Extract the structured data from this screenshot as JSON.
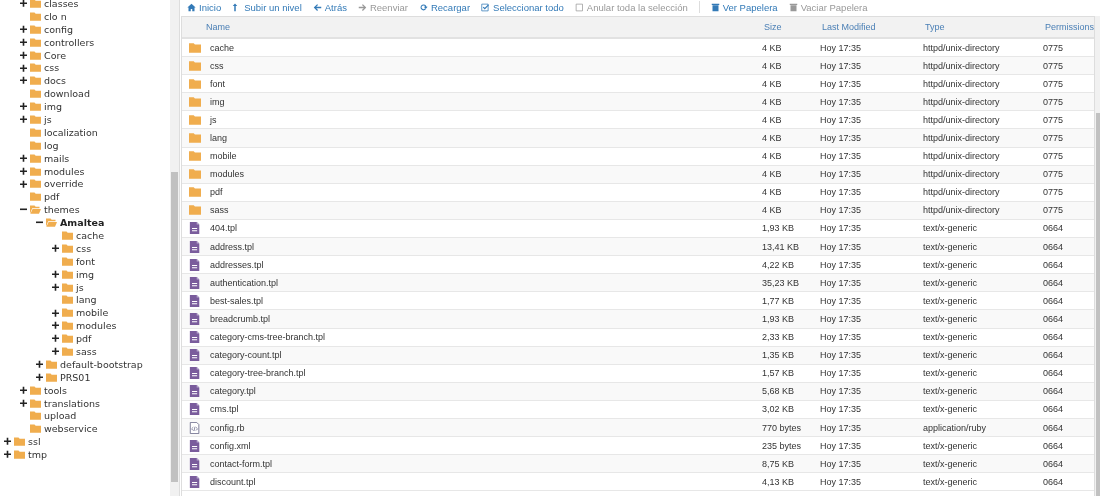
{
  "tree": {
    "items": [
      {
        "children": [
          {
            "label": "classes",
            "expandable": true,
            "expanded": false,
            "selected": false
          },
          {
            "label": "clo n",
            "expandable": false,
            "selected": false
          },
          {
            "label": "config",
            "expandable": true,
            "expanded": false,
            "selected": false
          },
          {
            "label": "controllers",
            "expandable": true,
            "expanded": false,
            "selected": false
          },
          {
            "label": "Core",
            "expandable": true,
            "expanded": false,
            "selected": false
          },
          {
            "label": "css",
            "expandable": true,
            "expanded": false,
            "selected": false
          },
          {
            "label": "docs",
            "expandable": true,
            "expanded": false,
            "selected": false
          },
          {
            "label": "download",
            "expandable": false,
            "selected": false
          },
          {
            "label": "img",
            "expandable": true,
            "expanded": false,
            "selected": false
          },
          {
            "label": "js",
            "expandable": true,
            "expanded": false,
            "selected": false
          },
          {
            "label": "localization",
            "expandable": false,
            "selected": false
          },
          {
            "label": "log",
            "expandable": false,
            "selected": false
          },
          {
            "label": "mails",
            "expandable": true,
            "expanded": false,
            "selected": false
          },
          {
            "label": "modules",
            "expandable": true,
            "expanded": false,
            "selected": false
          },
          {
            "label": "override",
            "expandable": true,
            "expanded": false,
            "selected": false
          },
          {
            "label": "pdf",
            "expandable": false,
            "selected": false
          },
          {
            "label": "themes",
            "expandable": true,
            "expanded": true,
            "selected": false,
            "children": [
              {
                "label": "Amaltea",
                "expandable": true,
                "expanded": true,
                "selected": true,
                "children": [
                  {
                    "label": "cache",
                    "expandable": false,
                    "selected": false
                  },
                  {
                    "label": "css",
                    "expandable": true,
                    "expanded": false,
                    "selected": false
                  },
                  {
                    "label": "font",
                    "expandable": false,
                    "selected": false
                  },
                  {
                    "label": "img",
                    "expandable": true,
                    "expanded": false,
                    "selected": false
                  },
                  {
                    "label": "js",
                    "expandable": true,
                    "expanded": false,
                    "selected": false
                  },
                  {
                    "label": "lang",
                    "expandable": false,
                    "selected": false
                  },
                  {
                    "label": "mobile",
                    "expandable": true,
                    "expanded": false,
                    "selected": false
                  },
                  {
                    "label": "modules",
                    "expandable": true,
                    "expanded": false,
                    "selected": false
                  },
                  {
                    "label": "pdf",
                    "expandable": true,
                    "expanded": false,
                    "selected": false
                  },
                  {
                    "label": "sass",
                    "expandable": true,
                    "expanded": false,
                    "selected": false
                  }
                ]
              },
              {
                "label": "default-bootstrap",
                "expandable": true,
                "expanded": false,
                "selected": false
              },
              {
                "label": "PRS01",
                "expandable": true,
                "expanded": false,
                "selected": false
              }
            ]
          },
          {
            "label": "tools",
            "expandable": true,
            "expanded": false,
            "selected": false
          },
          {
            "label": "translations",
            "expandable": true,
            "expanded": false,
            "selected": false
          },
          {
            "label": "upload",
            "expandable": false,
            "selected": false
          },
          {
            "label": "webservice",
            "expandable": false,
            "selected": false
          }
        ]
      },
      {
        "label": "ssl",
        "expandable": true,
        "expanded": false,
        "selected": false
      },
      {
        "label": "tmp",
        "expandable": true,
        "expanded": false,
        "selected": false
      }
    ]
  },
  "toolbar": [
    {
      "label": "Inicio",
      "kind": "home",
      "disabled": false
    },
    {
      "label": "Subir un nivel",
      "kind": "up",
      "disabled": false
    },
    {
      "label": "Atrás",
      "kind": "back",
      "disabled": false
    },
    {
      "label": "Reenviar",
      "kind": "forward",
      "disabled": true
    },
    {
      "label": "Recargar",
      "kind": "reload",
      "disabled": false
    },
    {
      "label": "Seleccionar todo",
      "kind": "check",
      "disabled": false
    },
    {
      "label": "Anular toda la selección",
      "kind": "uncheck",
      "disabled": true
    },
    {
      "label": "Ver Papelera",
      "kind": "trash",
      "disabled": false,
      "separated": true
    },
    {
      "label": "Vaciar Papelera",
      "kind": "trash",
      "disabled": true,
      "separated": false
    }
  ],
  "table": {
    "columns": [
      "Name",
      "Size",
      "Last Modified",
      "Type",
      "Permissions"
    ],
    "rows": [
      {
        "kind": "folder",
        "name": "cache",
        "size": "4 KB",
        "modified": "Hoy 17:35",
        "type": "httpd/unix-directory",
        "permissions": "0775"
      },
      {
        "kind": "folder",
        "name": "css",
        "size": "4 KB",
        "modified": "Hoy 17:35",
        "type": "httpd/unix-directory",
        "permissions": "0775"
      },
      {
        "kind": "folder",
        "name": "font",
        "size": "4 KB",
        "modified": "Hoy 17:35",
        "type": "httpd/unix-directory",
        "permissions": "0775"
      },
      {
        "kind": "folder",
        "name": "img",
        "size": "4 KB",
        "modified": "Hoy 17:35",
        "type": "httpd/unix-directory",
        "permissions": "0775"
      },
      {
        "kind": "folder",
        "name": "js",
        "size": "4 KB",
        "modified": "Hoy 17:35",
        "type": "httpd/unix-directory",
        "permissions": "0775"
      },
      {
        "kind": "folder",
        "name": "lang",
        "size": "4 KB",
        "modified": "Hoy 17:35",
        "type": "httpd/unix-directory",
        "permissions": "0775"
      },
      {
        "kind": "folder",
        "name": "mobile",
        "size": "4 KB",
        "modified": "Hoy 17:35",
        "type": "httpd/unix-directory",
        "permissions": "0775"
      },
      {
        "kind": "folder",
        "name": "modules",
        "size": "4 KB",
        "modified": "Hoy 17:35",
        "type": "httpd/unix-directory",
        "permissions": "0775"
      },
      {
        "kind": "folder",
        "name": "pdf",
        "size": "4 KB",
        "modified": "Hoy 17:35",
        "type": "httpd/unix-directory",
        "permissions": "0775"
      },
      {
        "kind": "folder",
        "name": "sass",
        "size": "4 KB",
        "modified": "Hoy 17:35",
        "type": "httpd/unix-directory",
        "permissions": "0775"
      },
      {
        "kind": "file",
        "name": "404.tpl",
        "size": "1,93 KB",
        "modified": "Hoy 17:35",
        "type": "text/x-generic",
        "permissions": "0664"
      },
      {
        "kind": "file",
        "name": "address.tpl",
        "size": "13,41 KB",
        "modified": "Hoy 17:35",
        "type": "text/x-generic",
        "permissions": "0664"
      },
      {
        "kind": "file",
        "name": "addresses.tpl",
        "size": "4,22 KB",
        "modified": "Hoy 17:35",
        "type": "text/x-generic",
        "permissions": "0664"
      },
      {
        "kind": "file",
        "name": "authentication.tpl",
        "size": "35,23 KB",
        "modified": "Hoy 17:35",
        "type": "text/x-generic",
        "permissions": "0664"
      },
      {
        "kind": "file",
        "name": "best-sales.tpl",
        "size": "1,77 KB",
        "modified": "Hoy 17:35",
        "type": "text/x-generic",
        "permissions": "0664"
      },
      {
        "kind": "file",
        "name": "breadcrumb.tpl",
        "size": "1,93 KB",
        "modified": "Hoy 17:35",
        "type": "text/x-generic",
        "permissions": "0664"
      },
      {
        "kind": "file",
        "name": "category-cms-tree-branch.tpl",
        "size": "2,33 KB",
        "modified": "Hoy 17:35",
        "type": "text/x-generic",
        "permissions": "0664"
      },
      {
        "kind": "file",
        "name": "category-count.tpl",
        "size": "1,35 KB",
        "modified": "Hoy 17:35",
        "type": "text/x-generic",
        "permissions": "0664"
      },
      {
        "kind": "file",
        "name": "category-tree-branch.tpl",
        "size": "1,57 KB",
        "modified": "Hoy 17:35",
        "type": "text/x-generic",
        "permissions": "0664"
      },
      {
        "kind": "file",
        "name": "category.tpl",
        "size": "5,68 KB",
        "modified": "Hoy 17:35",
        "type": "text/x-generic",
        "permissions": "0664"
      },
      {
        "kind": "file",
        "name": "cms.tpl",
        "size": "3,02 KB",
        "modified": "Hoy 17:35",
        "type": "text/x-generic",
        "permissions": "0664"
      },
      {
        "kind": "code",
        "name": "config.rb",
        "size": "770 bytes",
        "modified": "Hoy 17:35",
        "type": "application/ruby",
        "permissions": "0664"
      },
      {
        "kind": "file",
        "name": "config.xml",
        "size": "235 bytes",
        "modified": "Hoy 17:35",
        "type": "text/x-generic",
        "permissions": "0664"
      },
      {
        "kind": "file",
        "name": "contact-form.tpl",
        "size": "8,75 KB",
        "modified": "Hoy 17:35",
        "type": "text/x-generic",
        "permissions": "0664"
      },
      {
        "kind": "file",
        "name": "discount.tpl",
        "size": "4,13 KB",
        "modified": "Hoy 17:35",
        "type": "text/x-generic",
        "permissions": "0664"
      }
    ]
  }
}
